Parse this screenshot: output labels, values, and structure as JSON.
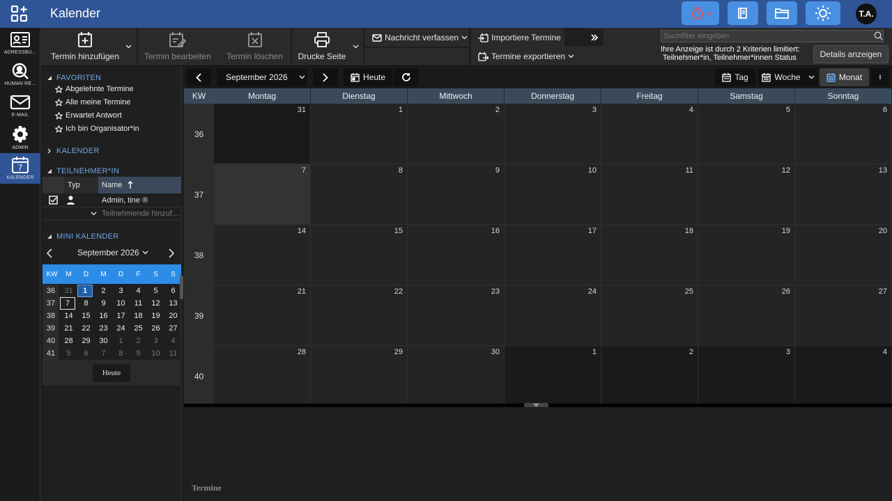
{
  "app": {
    "title": "Kalender"
  },
  "header": {
    "avatar_initials": "T.A.",
    "accent": "#2f5597",
    "button_color": "#4a90e2",
    "icons": [
      "apps-icon",
      "timer-icon",
      "book-icon",
      "folder-icon",
      "sun-icon"
    ]
  },
  "nav": {
    "items": [
      {
        "label": "ADRESSBU...",
        "icon": "address-book-icon"
      },
      {
        "label": "HUMAN RE...",
        "icon": "people-search-icon"
      },
      {
        "label": "E-MAIL",
        "icon": "envelope-icon"
      },
      {
        "label": "ADMIN",
        "icon": "gear-icon"
      },
      {
        "label": "KALENDER",
        "icon": "calendar-icon",
        "badge": "7",
        "active": true
      }
    ]
  },
  "toolbar": {
    "add": "Termin hinzufügen",
    "edit": "Termin bearbeiten",
    "delete": "Termin löschen",
    "print": "Drucke Seite",
    "message": "Nachricht verfassen",
    "import": "Importiere Termine",
    "export": "Termine exportieren"
  },
  "search": {
    "placeholder": "Suchfilter eingeben"
  },
  "filter": {
    "line1": "Ihre Anzeige ist durch 2 Kriterien limitiert:",
    "line2": "Teilnehmer*in, Teilnehmer*innen Status",
    "details_label": "Details anzeigen"
  },
  "sidebar": {
    "favorites_title": "FAVORITEN",
    "favorites": [
      "Abgelehnte Termine",
      "Alle meine Termine",
      "Erwartet Antwort",
      "Ich bin Organisator*in"
    ],
    "calendar_title": "KALENDER",
    "participants_title": "TEILNEHMER*IN",
    "participants_header": {
      "type": "Typ",
      "name": "Name"
    },
    "participants": [
      {
        "name": "Admin, tine ®"
      }
    ],
    "add_participant_placeholder": "Teilnehmende hinzuf…",
    "mini_title": "MINI KALENDER",
    "mini_month": "September 2026",
    "mini_weekday_headers": [
      "KW",
      "M",
      "D",
      "M",
      "D",
      "F",
      "S",
      "S"
    ],
    "mini_rows": [
      {
        "kw": "36",
        "days": [
          "31",
          "1",
          "2",
          "3",
          "4",
          "5",
          "6"
        ]
      },
      {
        "kw": "37",
        "days": [
          "7",
          "8",
          "9",
          "10",
          "11",
          "12",
          "13"
        ]
      },
      {
        "kw": "38",
        "days": [
          "14",
          "15",
          "16",
          "17",
          "18",
          "19",
          "20"
        ]
      },
      {
        "kw": "39",
        "days": [
          "21",
          "22",
          "23",
          "24",
          "25",
          "26",
          "27"
        ]
      },
      {
        "kw": "40",
        "days": [
          "28",
          "29",
          "30",
          "1",
          "2",
          "3",
          "4"
        ]
      },
      {
        "kw": "41",
        "days": [
          "5",
          "6",
          "7",
          "8",
          "9",
          "10",
          "11"
        ]
      }
    ],
    "today_label": "Heute"
  },
  "calendar": {
    "month_label": "September 2026",
    "today_label": "Heute",
    "views": {
      "day": "Tag",
      "week": "Woche",
      "month": "Monat"
    },
    "kw_header": "KW",
    "weekdays": [
      "Montag",
      "Dienstag",
      "Mittwoch",
      "Donnerstag",
      "Freitag",
      "Samstag",
      "Sonntag"
    ],
    "weeks": [
      {
        "kw": "36",
        "days": [
          "31",
          "1",
          "2",
          "3",
          "4",
          "5",
          "6"
        ]
      },
      {
        "kw": "37",
        "days": [
          "7",
          "8",
          "9",
          "10",
          "11",
          "12",
          "13"
        ]
      },
      {
        "kw": "38",
        "days": [
          "14",
          "15",
          "16",
          "17",
          "18",
          "19",
          "20"
        ]
      },
      {
        "kw": "39",
        "days": [
          "21",
          "22",
          "23",
          "24",
          "25",
          "26",
          "27"
        ]
      },
      {
        "kw": "40",
        "days": [
          "28",
          "29",
          "30",
          "1",
          "2",
          "3",
          "4"
        ]
      }
    ],
    "bottom_label": "Termine"
  }
}
